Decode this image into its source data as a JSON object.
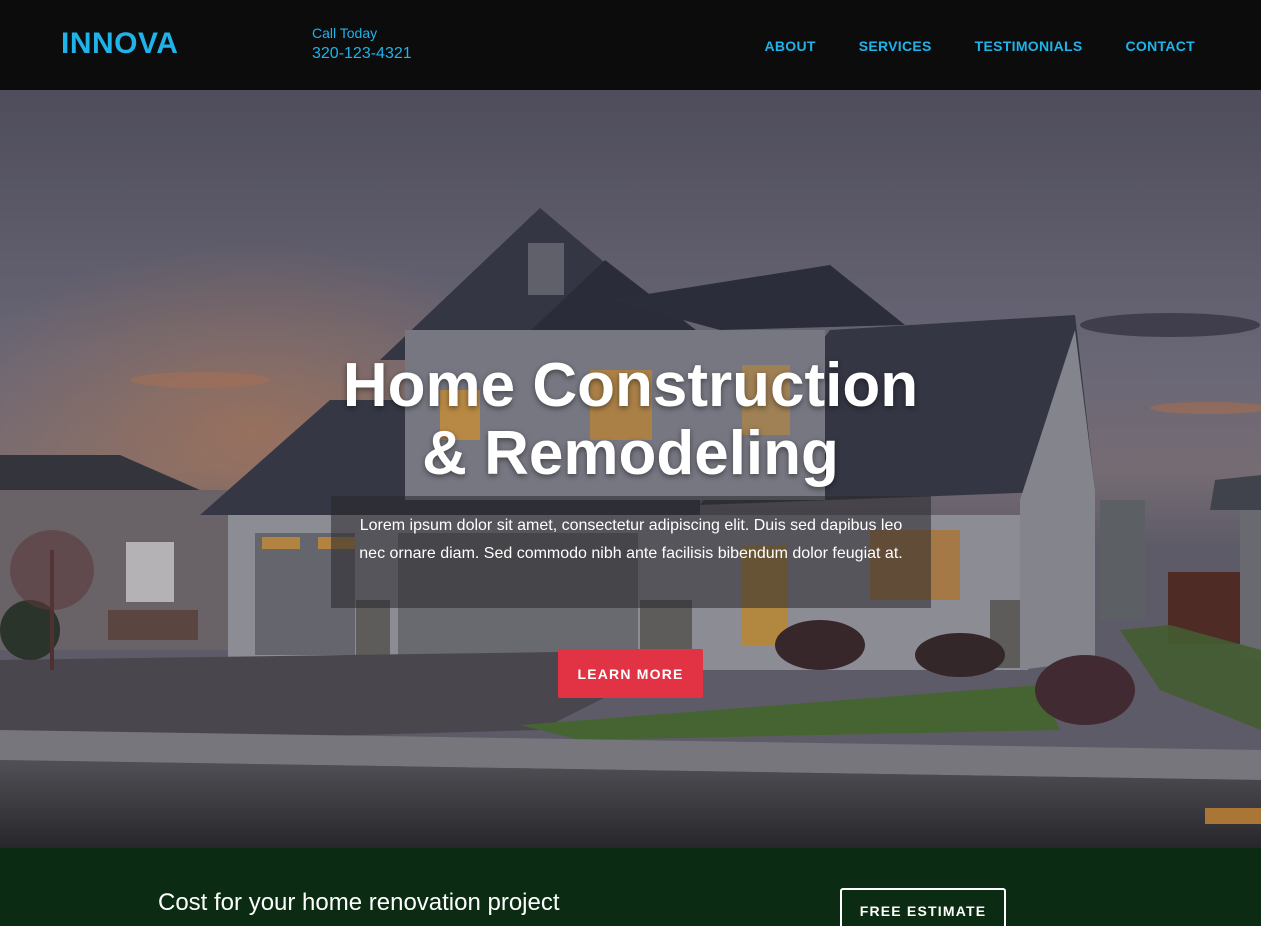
{
  "header": {
    "logo": "INNOVA",
    "call_label": "Call Today",
    "phone": "320-123-4321",
    "nav": [
      "ABOUT",
      "SERVICES",
      "TESTIMONIALS",
      "CONTACT"
    ]
  },
  "hero": {
    "title_line1": "Home Construction",
    "title_line2": "& Remodeling",
    "text": "Lorem ipsum dolor sit amet, consectetur adipiscing elit. Duis sed dapibus leo nec ornare diam. Sed commodo nibh ante facilisis bibendum dolor feugiat at.",
    "button": "LEARN MORE"
  },
  "cta": {
    "text": "Cost for your home renovation project",
    "button": "FREE ESTIMATE"
  },
  "colors": {
    "accent": "#1fb3ea",
    "button_red": "#e23344",
    "cta_band": "#0b2b12",
    "header_bg": "#0c0c0d"
  }
}
